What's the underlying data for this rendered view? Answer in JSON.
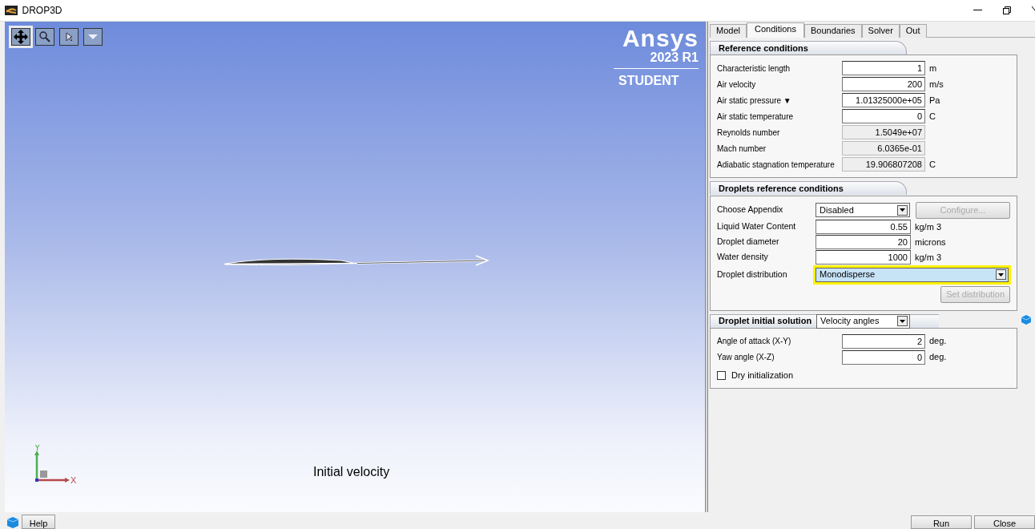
{
  "window": {
    "title": "DROP3D"
  },
  "viewport": {
    "tools": [
      {
        "kind": "pan",
        "selected": true
      },
      {
        "kind": "zoom",
        "selected": false
      },
      {
        "kind": "select",
        "selected": false
      },
      {
        "kind": "dropdown",
        "selected": false
      }
    ],
    "logo": {
      "name": "Ansys",
      "version": "2023 R1",
      "edition": "STUDENT"
    },
    "axes": {
      "y": "Y",
      "x": "X"
    },
    "caption": "Initial velocity"
  },
  "tabs": [
    {
      "label": "Model",
      "selected": false
    },
    {
      "label": "Conditions",
      "selected": true
    },
    {
      "label": "Boundaries",
      "selected": false
    },
    {
      "label": "Solver",
      "selected": false
    },
    {
      "label": "Out",
      "selected": false
    }
  ],
  "reference_conditions": {
    "title": "Reference conditions",
    "rows": [
      {
        "label": "Characteristic length",
        "value": "1",
        "unit": "m",
        "editable": true
      },
      {
        "label": "Air velocity",
        "value": "200",
        "unit": "m/s",
        "editable": true
      },
      {
        "label": "Air static pressure",
        "menu_glyph": "▼",
        "value": "1.01325000e+05",
        "unit": "Pa",
        "editable": true
      },
      {
        "label": "Air static temperature",
        "value": "0",
        "unit": "C",
        "editable": true
      },
      {
        "label": "Reynolds number",
        "value": "1.5049e+07",
        "editable": false
      },
      {
        "label": "Mach number",
        "value": "6.0365e-01",
        "editable": false
      },
      {
        "label": "Adiabatic stagnation temperature",
        "value": "19.906807208",
        "unit": "C",
        "editable": false
      }
    ]
  },
  "droplets_conditions": {
    "title": "Droplets reference conditions",
    "rows": [
      {
        "kind": "select",
        "label": "Choose Appendix",
        "value": "Disabled",
        "button": {
          "label": "Configure...",
          "disabled": true
        }
      },
      {
        "kind": "input",
        "label": "Liquid Water Content",
        "value": "0.55",
        "unit": "kg/m 3"
      },
      {
        "kind": "input",
        "label": "Droplet diameter",
        "value": "20",
        "unit": "microns"
      },
      {
        "kind": "input",
        "label": "Water density",
        "value": "1000",
        "unit": "kg/m 3"
      },
      {
        "kind": "wide-select",
        "label": "Droplet distribution",
        "value": "Monodisperse",
        "highlighted": true
      }
    ],
    "button": {
      "label": "Set distribution",
      "disabled": true
    }
  },
  "initial_solution": {
    "title": "Droplet initial solution",
    "mode": "Velocity angles",
    "rows": [
      {
        "label": "Angle of attack (X-Y)",
        "value": "2",
        "unit": "deg."
      },
      {
        "label": "Yaw angle (X-Z)",
        "value": "0",
        "unit": "deg."
      }
    ],
    "checkbox": {
      "label": "Dry initialization",
      "checked": false
    }
  },
  "footer": {
    "help": "Help",
    "run": "Run",
    "close": "Close"
  }
}
